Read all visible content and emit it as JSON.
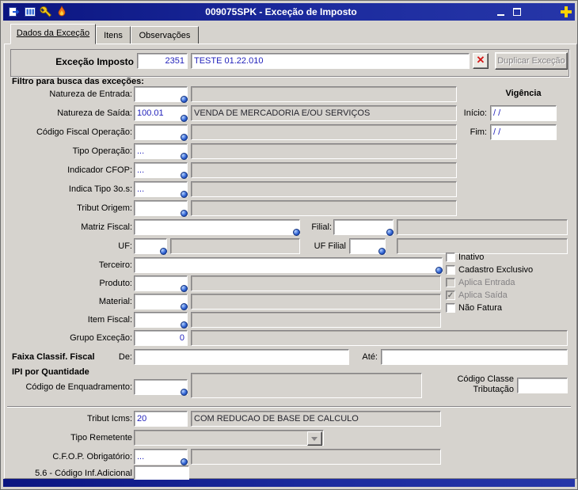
{
  "colors": {
    "titlebar": "#101c86",
    "accent_plus": "#ffd400",
    "delete_x": "#d41616",
    "value_text": "#2222bb"
  },
  "icons": {
    "titlebar": [
      "exit-icon",
      "columns-icon",
      "wrench-icon",
      "flame-icon"
    ],
    "field_lookup": "zoom-lookup-icon"
  },
  "window": {
    "title": "009075SPK - Exceção de Imposto"
  },
  "tabs": [
    {
      "label": "Dados da Exceção"
    },
    {
      "label": "Itens"
    },
    {
      "label": "Observações"
    }
  ],
  "header": {
    "label": "Exceção Imposto",
    "code": "2351",
    "description": "TESTE 01.22.010",
    "delete_button": "✕",
    "duplicate_button": "Duplicar Exceção"
  },
  "filter": {
    "title": "Filtro para busca das exceções:",
    "natureza_entrada": {
      "label": "Natureza de Entrada:",
      "value": "",
      "desc": ""
    },
    "natureza_saida": {
      "label": "Natureza de Saída:",
      "value": "100.01",
      "desc": "VENDA DE MERCADORIA E/OU SERVIÇOS"
    },
    "codigo_fiscal_operacao": {
      "label": "Código Fiscal Operação:",
      "value": "",
      "desc": ""
    },
    "tipo_operacao": {
      "label": "Tipo Operação:",
      "value": "...",
      "desc": ""
    },
    "indicador_cfop": {
      "label": "Indicador CFOP:",
      "value": "...",
      "desc": ""
    },
    "indica_tipo_3os": {
      "label": "Indica Tipo 3o.s:",
      "value": "...",
      "desc": ""
    },
    "tribut_origem": {
      "label": "Tribut Origem:",
      "value": "",
      "desc": ""
    },
    "matriz_fiscal": {
      "label": "Matriz Fiscal:",
      "value": ""
    },
    "filial": {
      "label": "Filial:",
      "value": "",
      "desc": ""
    },
    "uf": {
      "label": "UF:",
      "value": "",
      "desc": ""
    },
    "uf_filial": {
      "label": "UF Filial",
      "value": "",
      "desc": ""
    },
    "terceiro": {
      "label": "Terceiro:",
      "value": ""
    },
    "produto": {
      "label": "Produto:",
      "value": "",
      "desc": ""
    },
    "material": {
      "label": "Material:",
      "value": "",
      "desc": ""
    },
    "item_fiscal": {
      "label": "Item Fiscal:",
      "value": "",
      "desc": ""
    },
    "grupo_excecao": {
      "label": "Grupo Exceção:",
      "value": "0",
      "desc": ""
    },
    "vigencia": {
      "title": "Vigência",
      "inicio_label": "Início:",
      "inicio_value": "/ /",
      "fim_label": "Fim:",
      "fim_value": "/ /"
    }
  },
  "checkboxes": [
    {
      "label": "Inativo",
      "checked": false,
      "disabled": false,
      "glyph": ""
    },
    {
      "label": "Cadastro Exclusivo",
      "checked": false,
      "disabled": false,
      "glyph": ""
    },
    {
      "label": "Aplica Entrada",
      "checked": false,
      "disabled": true,
      "glyph": ""
    },
    {
      "label": "Aplica Saída",
      "checked": true,
      "disabled": true,
      "glyph": "✓"
    },
    {
      "label": "Não Fatura",
      "checked": false,
      "disabled": false,
      "glyph": ""
    }
  ],
  "faixa": {
    "title": "Faixa Classif. Fiscal",
    "de_label": "De:",
    "de_value": "",
    "ate_label": "Até:",
    "ate_value": ""
  },
  "ipi": {
    "title": "IPI por Quantidade",
    "enquadramento_label": "Código de Enquadramento:",
    "enquadramento_value": "",
    "enquadramento_desc": "",
    "classe_label": "Código Classe Tributação",
    "classe_value": ""
  },
  "bottom": {
    "tribut_icms": {
      "label": "Tribut Icms:",
      "value": "20",
      "desc": "COM REDUCAO DE BASE DE CALCULO"
    },
    "tipo_remetente": {
      "label": "Tipo Remetente",
      "value": ""
    },
    "cfop_obrigatorio": {
      "label": "C.F.O.P. Obrigatório:",
      "value": "...",
      "desc": ""
    },
    "codigo_inf_adicional": {
      "label": "5.6 - Código Inf.Adicional",
      "value": ""
    }
  }
}
